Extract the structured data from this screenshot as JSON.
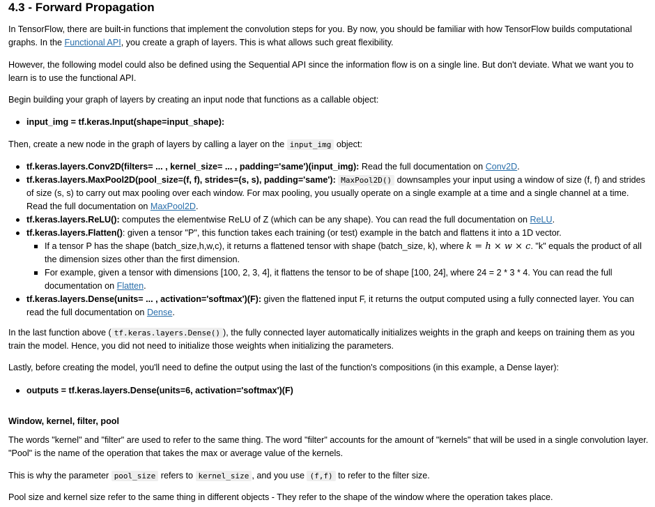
{
  "title": "4.3 - Forward Propagation",
  "p1": {
    "a": "In TensorFlow, there are built-in functions that implement the convolution steps for you. By now, you should be familiar with how TensorFlow builds computational graphs. In the ",
    "link": "Functional API",
    "b": ", you create a graph of layers. This is what allows such great flexibility."
  },
  "p2": "However, the following model could also be defined using the Sequential API since the information flow is on a single line. But don't deviate. What we want you to learn is to use the functional API.",
  "p3": "Begin building your graph of layers by creating an input node that functions as a callable object:",
  "bullet_input": "input_img = tf.keras.Input(shape=input_shape):",
  "p4": {
    "a": "Then, create a new node in the graph of layers by calling a layer on the ",
    "code": "input_img",
    "b": " object:"
  },
  "layers": {
    "conv": {
      "bold": "tf.keras.layers.Conv2D(filters= ... , kernel_size= ... , padding='same')(input_img):",
      "text": " Read the full documentation on ",
      "link": "Conv2D",
      "end": "."
    },
    "pool": {
      "bold": "tf.keras.layers.MaxPool2D(pool_size=(f, f), strides=(s, s), padding='same'):",
      "code": "MaxPool2D()",
      "text": " downsamples your input using a window of size (f, f) and strides of size (s, s) to carry out max pooling over each window. For max pooling, you usually operate on a single example at a time and a single channel at a time. Read the full documentation on ",
      "link": "MaxPool2D",
      "end": "."
    },
    "relu": {
      "bold": "tf.keras.layers.ReLU():",
      "text": " computes the elementwise ReLU of Z (which can be any shape). You can read the full documentation on ",
      "link": "ReLU",
      "end": "."
    },
    "flatten": {
      "bold": "tf.keras.layers.Flatten()",
      "text": ": given a tensor \"P\", this function takes each training (or test) example in the batch and flattens it into a 1D vector."
    },
    "flatten_sub1": {
      "a": "If a tensor P has the shape (batch_size,h,w,c), it returns a flattened tensor with shape (batch_size, k), where ",
      "math": "k = h × w × c",
      "b": ". \"k\" equals the product of all the dimension sizes other than the first dimension."
    },
    "flatten_sub2": {
      "a": "For example, given a tensor with dimensions [100, 2, 3, 4], it flattens the tensor to be of shape [100, 24], where 24 = 2 * 3 * 4. You can read the full documentation on ",
      "link": "Flatten",
      "end": "."
    },
    "dense": {
      "bold": "tf.keras.layers.Dense(units= ... , activation='softmax')(F):",
      "text": " given the flattened input F, it returns the output computed using a fully connected layer. You can read the full documentation on ",
      "link": "Dense",
      "end": "."
    }
  },
  "p5": {
    "a": "In the last function above (",
    "code": "tf.keras.layers.Dense()",
    "b": "), the fully connected layer automatically initializes weights in the graph and keeps on training them as you train the model. Hence, you did not need to initialize those weights when initializing the parameters."
  },
  "p6": "Lastly, before creating the model, you'll need to define the output using the last of the function's compositions (in this example, a Dense layer):",
  "bullet_output": "outputs = tf.keras.layers.Dense(units=6, activation='softmax')(F)",
  "h_window": "Window, kernel, filter, pool",
  "p7": "The words \"kernel\" and \"filter\" are used to refer to the same thing. The word \"filter\" accounts for the amount of \"kernels\" that will be used in a single convolution layer. \"Pool\" is the name of the operation that takes the max or average value of the kernels.",
  "p8": {
    "a": "This is why the parameter ",
    "code1": "pool_size",
    "b": " refers to ",
    "code2": "kernel_size",
    "c": ", and you use ",
    "code3": "(f,f)",
    "d": " to refer to the filter size."
  },
  "p9": "Pool size and kernel size refer to the same thing in different objects - They refer to the shape of the window where the operation takes place."
}
